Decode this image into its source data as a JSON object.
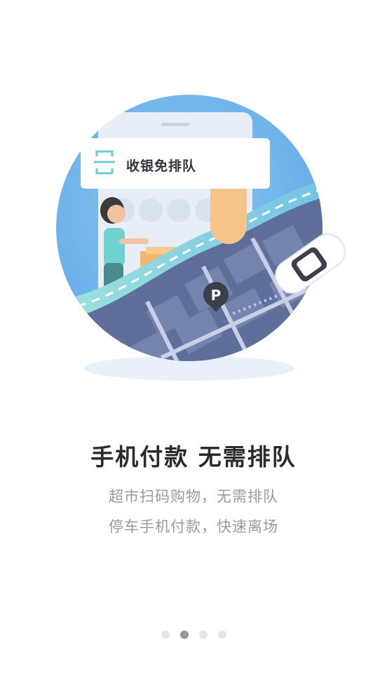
{
  "illustration": {
    "card_label": "收银免排队",
    "parking_icon_letter": "P"
  },
  "content": {
    "title": "手机付款 无需排队",
    "subtitle_line1": "超市扫码购物，无需排队",
    "subtitle_line2": "停车手机付款，快速离场"
  },
  "pagination": {
    "total": 4,
    "active_index": 1
  },
  "colors": {
    "circle_blue": "#6fb4ea",
    "road_teal": "#8fe0d8",
    "map_slate": "#5f6f99",
    "text_title": "#2b2b2b",
    "text_sub": "#9a9a9a",
    "dot_active": "#9a9a9a",
    "dot_inactive": "#e6e6e6"
  }
}
